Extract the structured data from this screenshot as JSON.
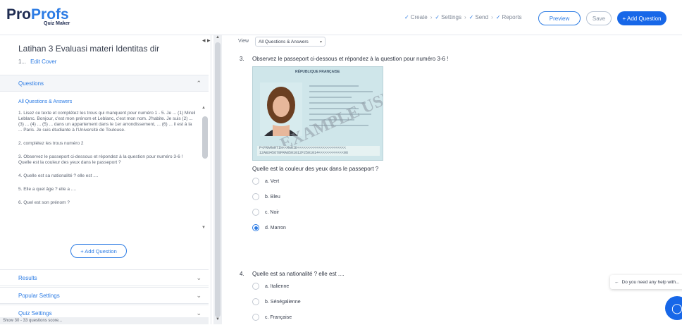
{
  "header": {
    "logo_part1": "Pro",
    "logo_part2": "Profs",
    "logo_sub": "Quiz Maker",
    "steps": [
      "Create",
      "Settings",
      "Send",
      "Reports"
    ],
    "preview_label": "Preview",
    "save_label": "Save",
    "add_question_label": "+ Add Question"
  },
  "sidebar": {
    "quiz_title": "Latihan 3 Evaluasi materi Identitas dir",
    "quiz_sub": "1...",
    "quiz_sub_link": "Edit Cover",
    "questions_header": "Questions",
    "all_questions_label": "All Questions & Answers",
    "questions": [
      "1. Lisez ce texte et complétez les trous qui manquent pour numéro 1 - 5. Je ... (1) Mireil Leblanc. Bonjour, c'est mon prénom et Leblanc, c'est mon nom. J'habite. Je suis (2) ... (3) ... (4) ... (5) ... dans un appartement dans le 1er arrondissement, ... (6) ... il est à la ... Paris. Je suis étudiante à l'Université de Toulouse.",
      "2. complétez les trous numéro 2",
      "3. Observez le passeport ci-dessous et répondez à la question pour numéro 3-6 ! Quelle est la couleur des yeux dans le passeport ?",
      "4. Quelle est sa nationalité ? elle est ....",
      "5. Elle a quel âge ? elle a ....",
      "6. Quel est son prénom ?"
    ],
    "add_question_btn": "+ Add Question",
    "sections": [
      "Results",
      "Popular Settings",
      "Quiz Settings"
    ],
    "status_text": "Show 30 - 33 questions score..."
  },
  "main": {
    "view_label": "View",
    "view_select_value": "All Questions & Answers",
    "q3": {
      "number": "3.",
      "text": "Observez le passeport ci-dessous et répondez à la question pour numéro 3-6 !",
      "passport_header": "RÉPUBLIQUE FRANÇAISE",
      "passport_watermark": "EXAMPLE USE ONLY",
      "passport_mrz1": "P<FRAMARTIN<<MARIE<<<<<<<<<<<<<<<<<<<<<<<",
      "passport_mrz2": "12AB345678FRA8501012F2501014<<<<<<<<<<<<06",
      "subquestion": "Quelle est la couleur des yeux dans le passeport ?",
      "options": [
        "a. Vert",
        "b. Bleu",
        "c. Noir",
        "d. Marron"
      ],
      "selected_index": 3
    },
    "q4": {
      "number": "4.",
      "text": "Quelle est sa nationalité ? elle est ....",
      "options": [
        "a. Italienne",
        "b. Sénégalienne",
        "c. Française"
      ]
    }
  },
  "help_popup": "Do you need any help with...",
  "colors": {
    "accent": "#1767e8",
    "link": "#2b7be4"
  },
  "icons": [
    "check-icon",
    "chevron-down-icon",
    "collapse-icon",
    "chat-icon",
    "back-arrow-icon"
  ]
}
